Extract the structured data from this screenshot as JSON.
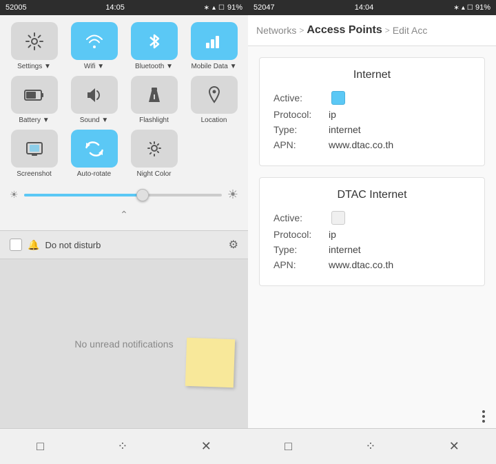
{
  "left": {
    "statusBar": {
      "carrier": "52005",
      "time": "14:05",
      "bluetooth": "B",
      "wifi": "W",
      "battery": "91%"
    },
    "controls": [
      {
        "id": "settings",
        "icon": "⚙",
        "label": "Settings ▼",
        "active": false
      },
      {
        "id": "wifi",
        "icon": "⌾",
        "label": "Wifi ▼",
        "active": true
      },
      {
        "id": "bluetooth",
        "icon": "✴",
        "label": "Bluetooth ▼",
        "active": true
      },
      {
        "id": "mobiledata",
        "icon": "⊞",
        "label": "Mobile Data ▼",
        "active": true
      },
      {
        "id": "battery",
        "icon": "▬",
        "label": "Battery ▼",
        "active": false
      },
      {
        "id": "sound",
        "icon": "◗",
        "label": "Sound ▼",
        "active": false
      },
      {
        "id": "flashlight",
        "icon": "→",
        "label": "Flashlight",
        "active": false
      },
      {
        "id": "location",
        "icon": "⚲",
        "label": "Location",
        "active": false
      },
      {
        "id": "screenshot",
        "icon": "▤",
        "label": "Screenshot",
        "active": false
      },
      {
        "id": "autorotate",
        "icon": "↺",
        "label": "Auto-rotate",
        "active": true
      },
      {
        "id": "nightcolor",
        "icon": "💡",
        "label": "Night Color",
        "active": false
      }
    ],
    "brightness": {
      "value": 60
    },
    "notification": {
      "dnd_label": "Do not disturb",
      "empty_text": "No unread notifications"
    },
    "bottomNav": {
      "square": "□",
      "dots": "⁘",
      "close": "✕"
    }
  },
  "right": {
    "statusBar": {
      "carrier": "52047",
      "time": "14:04",
      "bluetooth": "B",
      "wifi": "W",
      "battery": "91%"
    },
    "breadcrumb": {
      "networks": "Networks",
      "sep1": ">",
      "access_points": "Access Points",
      "sep2": ">",
      "edit": "Edit Acc"
    },
    "apns": [
      {
        "title": "Internet",
        "active": true,
        "protocol": "ip",
        "type": "internet",
        "apn": "www.dtac.co.th"
      },
      {
        "title": "DTAC Internet",
        "active": false,
        "protocol": "ip",
        "type": "internet",
        "apn": "www.dtac.co.th"
      }
    ],
    "fieldLabels": {
      "active": "Active:",
      "protocol": "Protocol:",
      "type": "Type:",
      "apn": "APN:"
    },
    "bottomNav": {
      "square": "□",
      "dots": "⁘",
      "close": "✕"
    }
  }
}
